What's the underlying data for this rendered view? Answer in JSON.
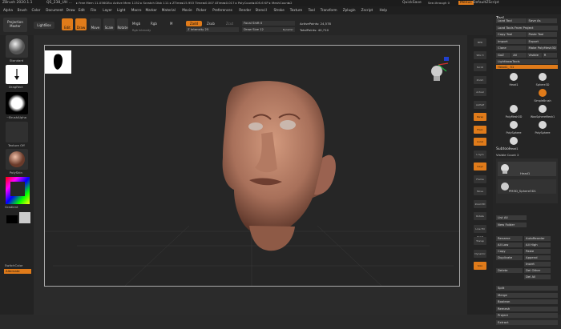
{
  "titlebar": {
    "app": "ZBrush 2020.1.1",
    "file": "QS_238_UH ...",
    "stats": "▸ Free Mem 11.056GB ▸ Active Mem 1152 ▸ Scratch Disk 111 ▸ ZTime▸15.953 Timer▸0.007 ATime▸0.017 ▸ PolyCount▸405.6 KP ▸ MeshCount▸2",
    "quicksave": "QuickSave",
    "seethrough": "See-through 0",
    "menus": "Menus",
    "zscript": "DefaultZScript"
  },
  "menubar": [
    "Alpha",
    "Brush",
    "Color",
    "Document",
    "Draw",
    "Edit",
    "File",
    "Layer",
    "Light",
    "Macro",
    "Marker",
    "Material",
    "Movie",
    "Picker",
    "Preferences",
    "Render",
    "Stencil",
    "Stroke",
    "Texture",
    "Tool",
    "Transform",
    "Zplugin",
    "Zscript",
    "Help"
  ],
  "toolbar": {
    "projection": "Projection Master",
    "lightbox": "LightBox",
    "edit": "Edit",
    "draw": "Draw",
    "move": "Move",
    "scale": "Scale",
    "rotate": "Rotate",
    "mrgb": "Mrgb",
    "rgb": "Rgb",
    "m": "M",
    "rgb_intensity": "Rgb Intensity",
    "zadd": "Zadd",
    "zsub": "Zsub",
    "zcut": "Zcut",
    "z_intensity": "Z Intensity 25",
    "focal_shift": "Focal Shift 0",
    "draw_size": "Draw Size 12",
    "dynamic": "Dynamic",
    "active_points": "ActivePoints: 24,578",
    "total_points": "TotalPoints: 40,710"
  },
  "leftshelf": {
    "brush": "Standard",
    "stroke": "DragRect",
    "alpha": "~BrushAlpha",
    "texture": "Texture Off",
    "material": "PolySkin",
    "gradient": "Gradient",
    "switchcolor": "SwitchColor",
    "alternate": "Alternate"
  },
  "rightshelf": [
    "BPR",
    "SPix 3",
    "Scroll",
    "Zoom",
    "Actual",
    "AAHalf",
    "Persp",
    "Floor",
    "Local",
    "L.Sym",
    "Gxyz",
    "Frame",
    "Move",
    "Zoom3D",
    "Rotate",
    "Line Fill PolyF",
    "Transp",
    "Dynamic",
    "Solo"
  ],
  "tool_panel": {
    "header": "Tool",
    "buttons": [
      [
        "Load Tool",
        "Save As"
      ],
      [
        "Load Tools From Project"
      ],
      [
        "Copy Tool",
        "Paste Tool"
      ],
      [
        "Import",
        "Export"
      ],
      [
        "Clone",
        "Make PolyMesh3D"
      ],
      [
        "GoZ",
        "All",
        "Visible",
        "R"
      ]
    ],
    "lightbox_tools": "Lightbox▸Tools",
    "current_tool": "Head1_ 51",
    "tools": [
      "Head1",
      "Sphere3D",
      "SimpleBrush",
      "PolyMesh3D",
      "WaxSphereMesh1",
      "PolySphere",
      "PolySphere",
      "Head1"
    ],
    "subtool": "Subtool",
    "visible_count": "Visible Count 2",
    "subtool_items": [
      "Head1",
      "PM3D_Sphere3D1"
    ],
    "list_all": "List All",
    "new_folder": "New Folder",
    "actions": [
      [
        "Rename",
        "AutoReorder"
      ],
      [
        "All Low",
        "All High"
      ],
      [
        "Copy",
        "Paste"
      ],
      [
        "Duplicate",
        "Append"
      ],
      [
        "",
        "Insert"
      ],
      [
        "Delete",
        "Del Other"
      ],
      [
        "",
        "Del All"
      ]
    ],
    "more": [
      "Split",
      "Merge",
      "Boolean",
      "Remesh",
      "Project",
      "Extract"
    ]
  },
  "colors": {
    "accent": "#e07b1a",
    "skin": "#a8705a"
  }
}
